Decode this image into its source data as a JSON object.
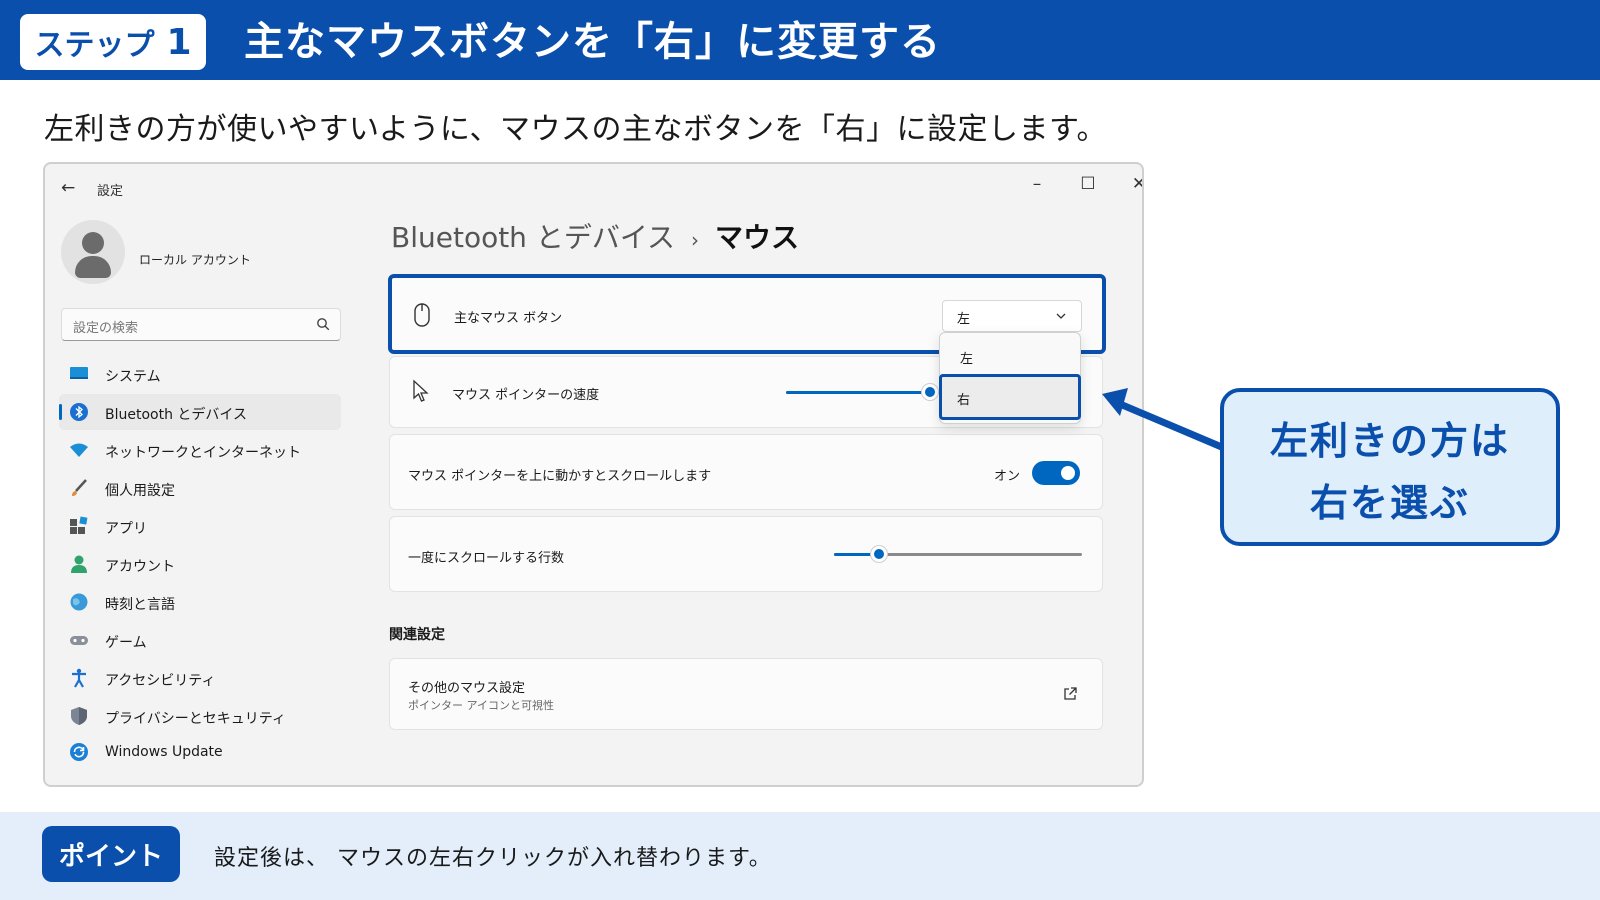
{
  "header": {
    "step_label": "ステップ",
    "step_number": "1",
    "title": "主なマウスボタンを「右」に変更する"
  },
  "intro": "左利きの方が使いやすいように、マウスの主なボタンを「右」に設定します。",
  "window": {
    "app_title": "設定",
    "controls": {
      "minimize": "–",
      "maximize": "☐",
      "close": "✕"
    }
  },
  "sidebar": {
    "account_name": "ローカル アカウント",
    "search_placeholder": "設定の検索",
    "items": [
      {
        "label": "システム",
        "icon": "system-icon"
      },
      {
        "label": "Bluetooth とデバイス",
        "icon": "bluetooth-icon",
        "active": true
      },
      {
        "label": "ネットワークとインターネット",
        "icon": "wifi-icon"
      },
      {
        "label": "個人用設定",
        "icon": "brush-icon"
      },
      {
        "label": "アプリ",
        "icon": "apps-icon"
      },
      {
        "label": "アカウント",
        "icon": "account-icon"
      },
      {
        "label": "時刻と言語",
        "icon": "globe-icon"
      },
      {
        "label": "ゲーム",
        "icon": "gamepad-icon"
      },
      {
        "label": "アクセシビリティ",
        "icon": "accessibility-icon"
      },
      {
        "label": "プライバシーとセキュリティ",
        "icon": "shield-icon"
      },
      {
        "label": "Windows Update",
        "icon": "update-icon"
      }
    ]
  },
  "main": {
    "breadcrumb_parent": "Bluetooth とデバイス",
    "breadcrumb_sep": "›",
    "breadcrumb_current": "マウス",
    "primary_button": {
      "label": "主なマウス ボタン",
      "value": "左",
      "options": [
        "左",
        "右"
      ],
      "highlighted_option": "右"
    },
    "pointer_speed": {
      "label": "マウス ポインターの速度",
      "level": 0.6
    },
    "scroll_inactive": {
      "label": "マウス ポインターを上に動かすとスクロールします",
      "state_label": "オン",
      "on": true
    },
    "scroll_lines": {
      "label": "一度にスクロールする行数",
      "level": 0.18
    },
    "related_title": "関連設定",
    "more_settings": {
      "label": "その他のマウス設定",
      "sub": "ポインター アイコンと可視性"
    }
  },
  "callout": {
    "line1": "左利きの方は",
    "line2": "右を選ぶ"
  },
  "footer": {
    "badge": "ポイント",
    "text": "設定後は、 マウスの左右クリックが入れ替わります。"
  },
  "colors": {
    "brand": "#0b4fad",
    "accent": "#0067c0",
    "footer_bg": "#e3eefa"
  }
}
